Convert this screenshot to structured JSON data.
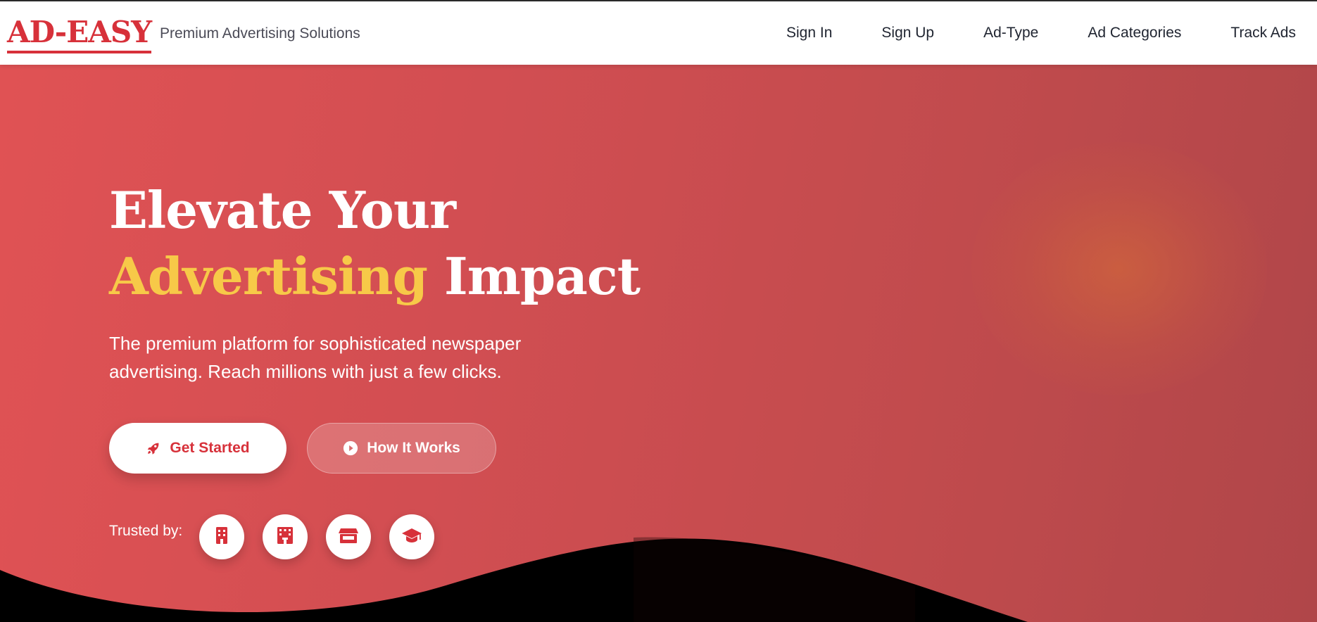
{
  "brand": {
    "logo": "AD-EASY",
    "tagline": "Premium Advertising Solutions"
  },
  "nav": {
    "items": [
      "Sign In",
      "Sign Up",
      "Ad-Type",
      "Ad Categories",
      "Track Ads"
    ]
  },
  "hero": {
    "headline_line1": "Elevate Your",
    "headline_accent": "Advertising",
    "headline_rest": " Impact",
    "subtitle": "The premium platform for sophisticated newspaper advertising. Reach millions with just a few clicks.",
    "primary_button": {
      "label": "Get Started",
      "icon": "rocket-icon"
    },
    "secondary_button": {
      "label": "How It Works",
      "icon": "play-circle-icon"
    },
    "trusted_label": "Trusted by:",
    "trusted_icons": [
      "building-icon",
      "hotel-icon",
      "store-icon",
      "graduation-cap-icon"
    ]
  },
  "colors": {
    "brand_red": "#d7313a",
    "accent_yellow": "#f7c948",
    "hero_start": "#e05254",
    "hero_end": "#b04649"
  }
}
